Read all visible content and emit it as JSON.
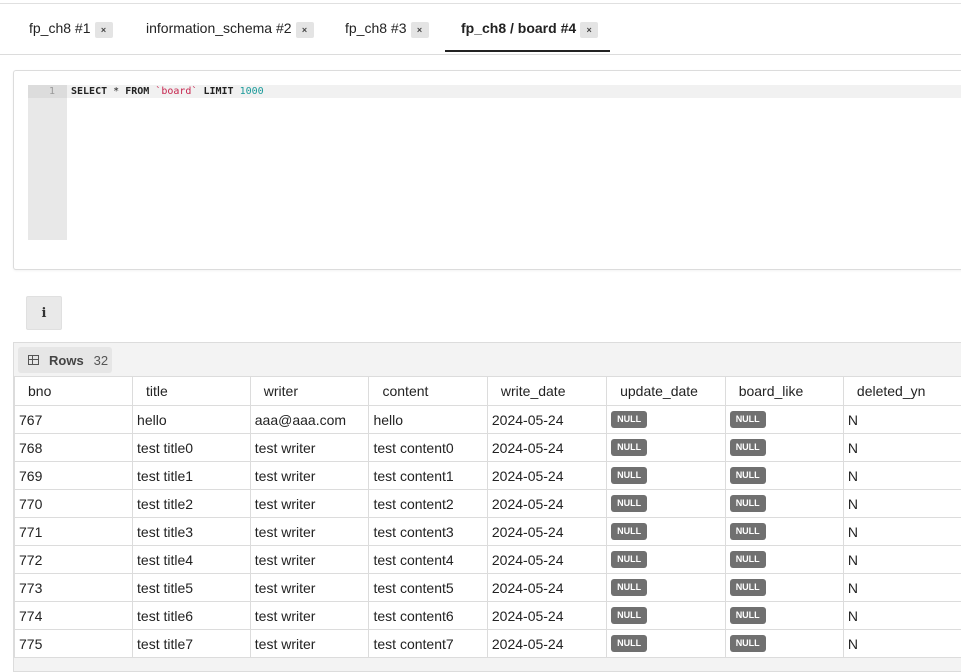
{
  "tabs": [
    {
      "label": "fp_ch8 #1",
      "close": "×",
      "active": false
    },
    {
      "label": "information_schema #2",
      "close": "×",
      "active": false
    },
    {
      "label": "fp_ch8 #3",
      "close": "×",
      "active": false
    },
    {
      "label": "fp_ch8 / board #4",
      "close": "×",
      "active": true
    }
  ],
  "editor": {
    "line_number": "1",
    "query": {
      "kw1": "SELECT",
      "star": " * ",
      "kw2": "FROM",
      "table": " `board` ",
      "kw3": "LIMIT",
      "limit": " 1000"
    }
  },
  "info_button": {
    "icon": "info-icon",
    "glyph": "i"
  },
  "results": {
    "rows_label": "Rows",
    "rows_count": "32",
    "columns": [
      "bno",
      "title",
      "writer",
      "content",
      "write_date",
      "update_date",
      "board_like",
      "deleted_yn"
    ],
    "null_text": "NULL",
    "rows": [
      [
        "767",
        "hello",
        "aaa@aaa.com",
        "hello",
        "2024-05-24",
        "NULL",
        "NULL",
        "N"
      ],
      [
        "768",
        "test title0",
        "test writer",
        "test content0",
        "2024-05-24",
        "NULL",
        "NULL",
        "N"
      ],
      [
        "769",
        "test title1",
        "test writer",
        "test content1",
        "2024-05-24",
        "NULL",
        "NULL",
        "N"
      ],
      [
        "770",
        "test title2",
        "test writer",
        "test content2",
        "2024-05-24",
        "NULL",
        "NULL",
        "N"
      ],
      [
        "771",
        "test title3",
        "test writer",
        "test content3",
        "2024-05-24",
        "NULL",
        "NULL",
        "N"
      ],
      [
        "772",
        "test title4",
        "test writer",
        "test content4",
        "2024-05-24",
        "NULL",
        "NULL",
        "N"
      ],
      [
        "773",
        "test title5",
        "test writer",
        "test content5",
        "2024-05-24",
        "NULL",
        "NULL",
        "N"
      ],
      [
        "774",
        "test title6",
        "test writer",
        "test content6",
        "2024-05-24",
        "NULL",
        "NULL",
        "N"
      ],
      [
        "775",
        "test title7",
        "test writer",
        "test content7",
        "2024-05-24",
        "NULL",
        "NULL",
        "N"
      ]
    ]
  },
  "colors": {
    "null_badge": "#707070",
    "string_literal": "#c7254e",
    "number_literal": "#1a9a9a"
  }
}
